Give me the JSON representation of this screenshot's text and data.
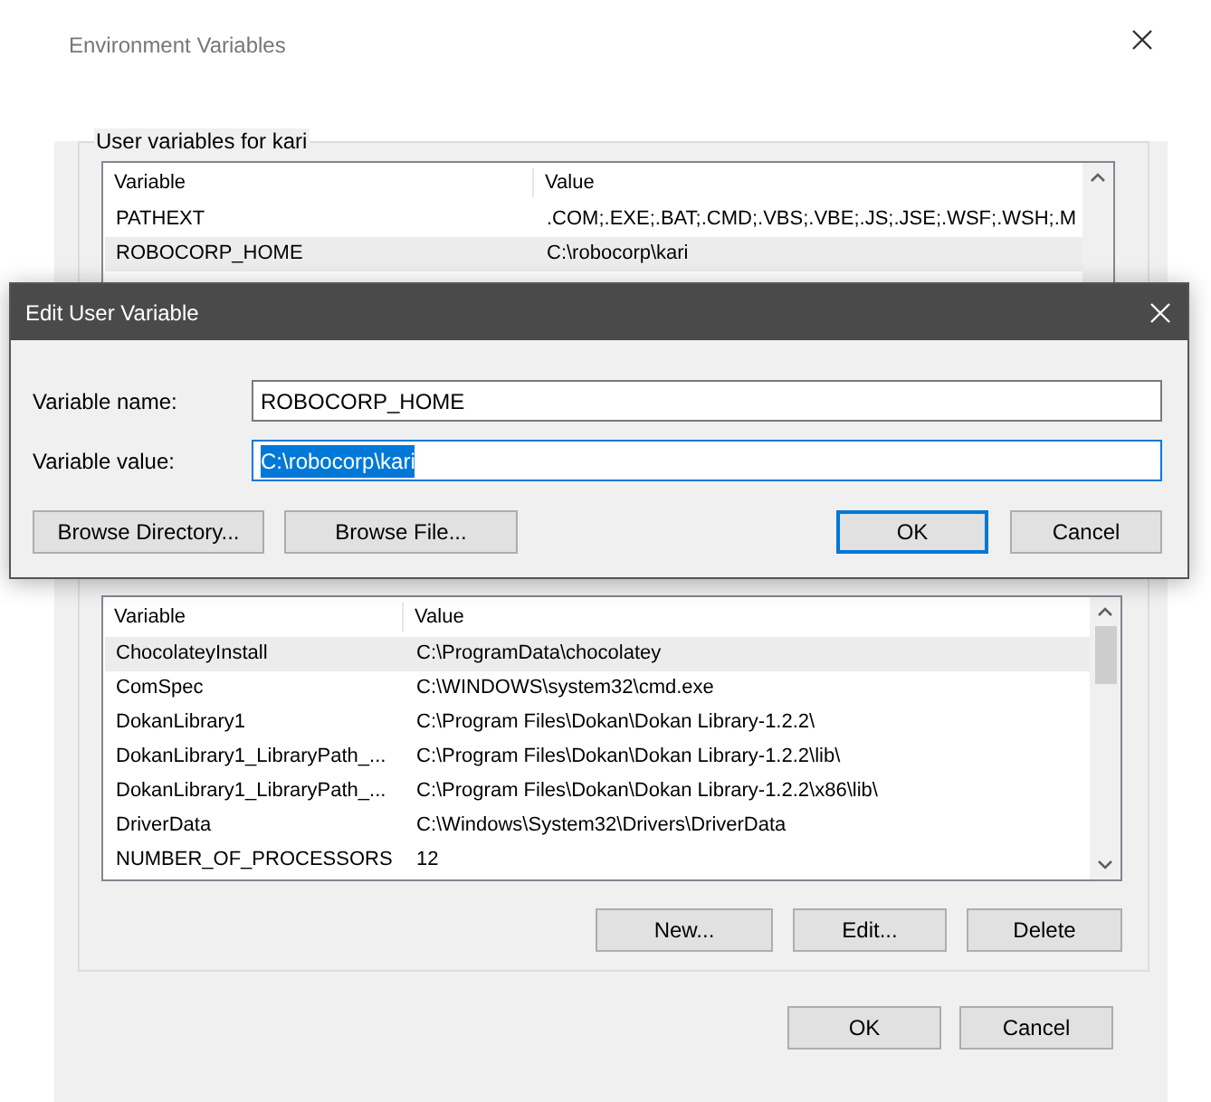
{
  "window": {
    "title": "Environment Variables"
  },
  "user_variables": {
    "title": "User variables for kari",
    "columns": [
      "Variable",
      "Value"
    ],
    "rows": [
      {
        "variable": "PATHEXT",
        "value": ".COM;.EXE;.BAT;.CMD;.VBS;.VBE;.JS;.JSE;.WSF;.WSH;.M",
        "selected": false
      },
      {
        "variable": "ROBOCORP_HOME",
        "value": "C:\\robocorp\\kari",
        "selected": true
      }
    ]
  },
  "system_variables": {
    "columns": [
      "Variable",
      "Value"
    ],
    "rows": [
      {
        "variable": "ChocolateyInstall",
        "value": "C:\\ProgramData\\chocolatey",
        "selected": true
      },
      {
        "variable": "ComSpec",
        "value": "C:\\WINDOWS\\system32\\cmd.exe",
        "selected": false
      },
      {
        "variable": "DokanLibrary1",
        "value": "C:\\Program Files\\Dokan\\Dokan Library-1.2.2\\",
        "selected": false
      },
      {
        "variable": "DokanLibrary1_LibraryPath_...",
        "value": "C:\\Program Files\\Dokan\\Dokan Library-1.2.2\\lib\\",
        "selected": false
      },
      {
        "variable": "DokanLibrary1_LibraryPath_...",
        "value": "C:\\Program Files\\Dokan\\Dokan Library-1.2.2\\x86\\lib\\",
        "selected": false
      },
      {
        "variable": "DriverData",
        "value": "C:\\Windows\\System32\\Drivers\\DriverData",
        "selected": false
      },
      {
        "variable": "NUMBER_OF_PROCESSORS",
        "value": "12",
        "selected": false
      }
    ],
    "buttons": [
      "New...",
      "Edit...",
      "Delete"
    ]
  },
  "buttons": [
    {
      "label": "OK",
      "default": false
    },
    {
      "label": "Cancel",
      "default": false
    }
  ],
  "edit_dialog": {
    "title": "Edit User Variable",
    "fields": [
      {
        "label": "Variable name:",
        "value": "ROBOCORP_HOME",
        "focused": false
      },
      {
        "label": "Variable value:",
        "value": "C:\\robocorp\\kari",
        "focused": true
      }
    ],
    "buttons": [
      {
        "label": "Browse Directory...",
        "default": false
      },
      {
        "label": "Browse File...",
        "default": false
      },
      {
        "label": "OK",
        "default": true
      },
      {
        "label": "Cancel",
        "default": false
      }
    ]
  }
}
